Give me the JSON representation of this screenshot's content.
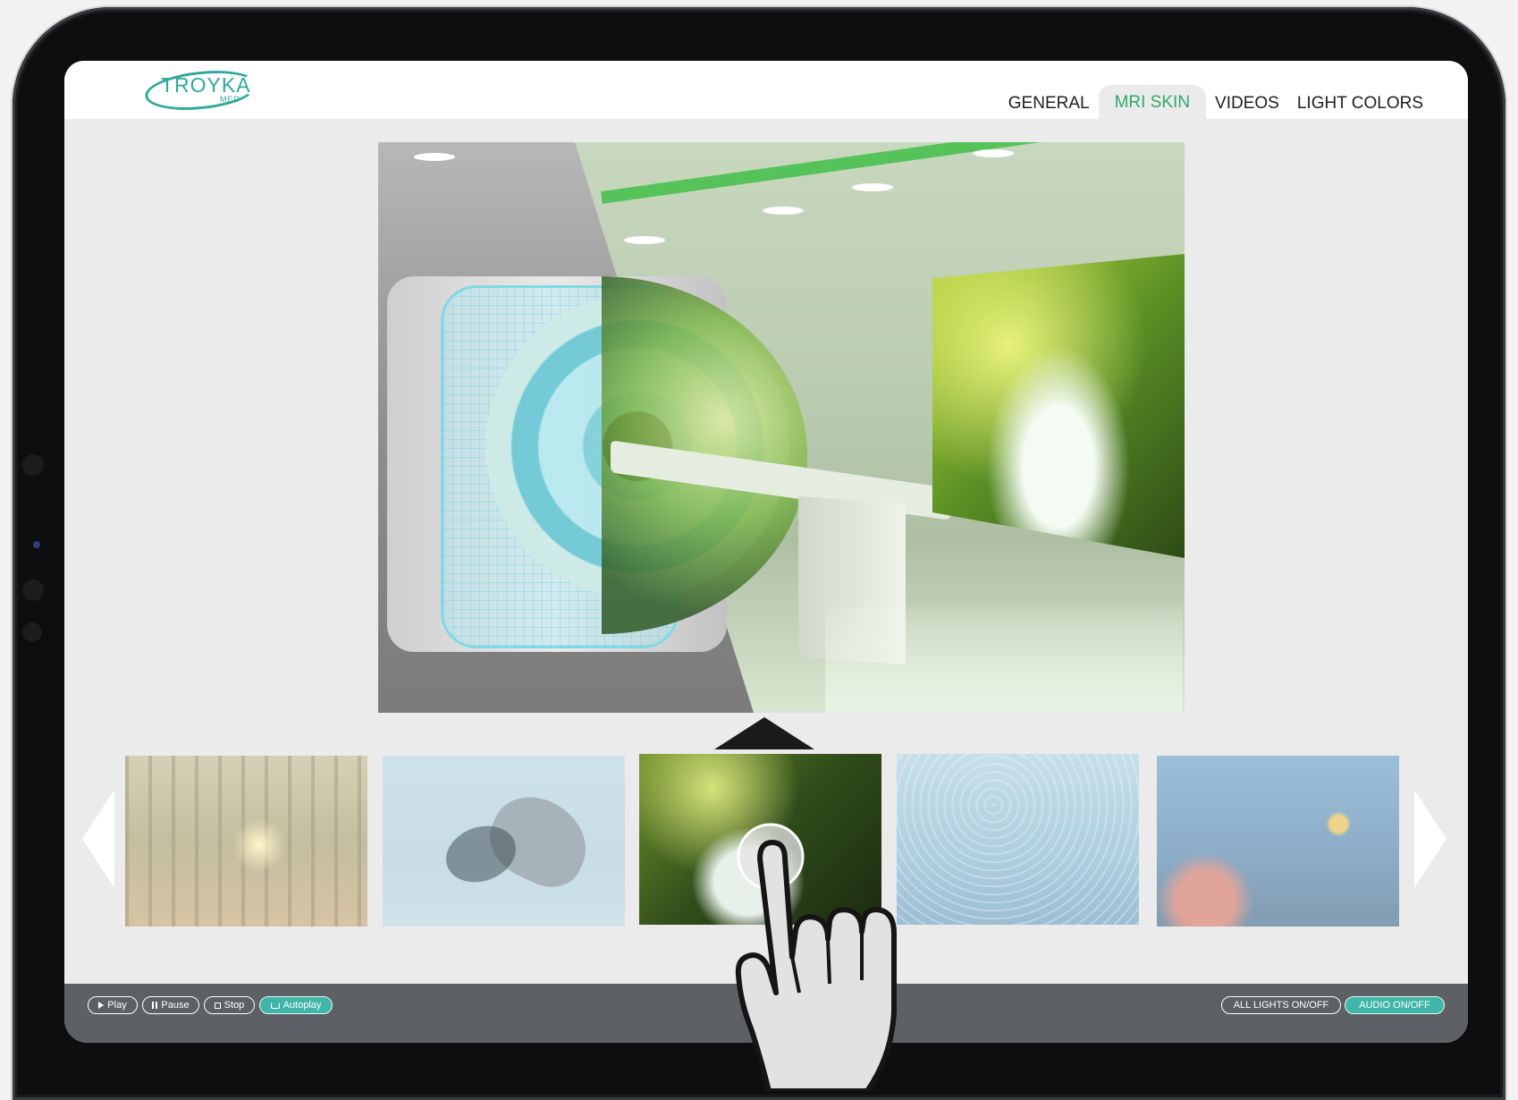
{
  "app": {
    "logo_text": "TROYKA",
    "logo_sub": "MED"
  },
  "nav": {
    "tabs": [
      {
        "label": "GENERAL",
        "active": false
      },
      {
        "label": "MRI SKIN",
        "active": true
      },
      {
        "label": "VIDEOS",
        "active": false
      },
      {
        "label": "LIGHT COLORS",
        "active": false
      }
    ]
  },
  "gallery": {
    "selected_index": 2,
    "thumbnails": [
      "forest-sunlight",
      "orca-underwater",
      "forest-stream",
      "fish-school",
      "coral-reef"
    ]
  },
  "controls": {
    "play": "Play",
    "pause": "Pause",
    "stop": "Stop",
    "autoplay": "Autoplay",
    "all_lights": "ALL LIGHTS ON/OFF",
    "audio": "AUDIO ON/OFF"
  },
  "icons": {
    "prev": "chevron-left-icon",
    "next": "chevron-right-icon",
    "pointer": "hand-pointer-icon"
  },
  "colors": {
    "accent": "#3fb6a8",
    "active_tab_text": "#2fa86a",
    "bar": "#5d6166"
  }
}
